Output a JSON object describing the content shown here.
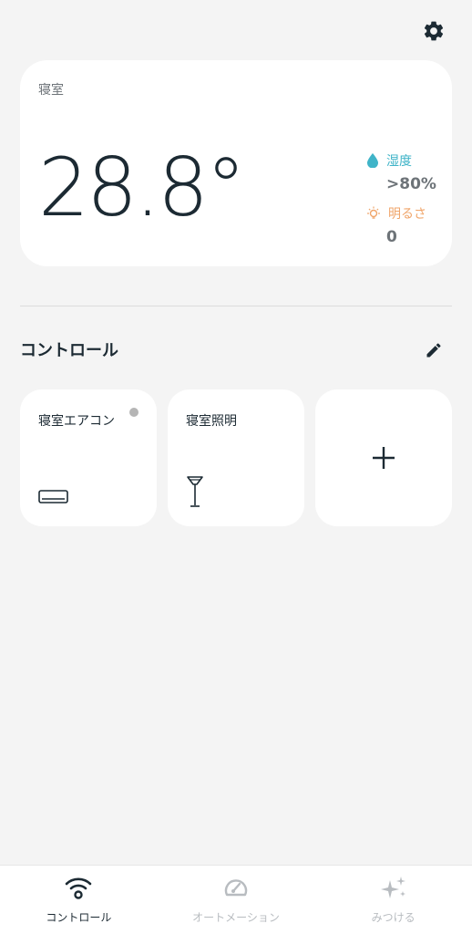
{
  "room": {
    "name": "寝室",
    "temperature": "28.8°",
    "humidity_label": "湿度",
    "humidity_value": ">80%",
    "brightness_label": "明るさ",
    "brightness_value": "0"
  },
  "controls": {
    "title": "コントロール",
    "devices": [
      {
        "label": "寝室エアコン",
        "icon": "air-conditioner-icon",
        "status": "offline"
      },
      {
        "label": "寝室照明",
        "icon": "floor-lamp-icon"
      }
    ],
    "add_icon": "plus-icon"
  },
  "tabs": [
    {
      "label": "コントロール",
      "icon": "wifi-icon",
      "active": true
    },
    {
      "label": "オートメーション",
      "icon": "automation-icon",
      "active": false
    },
    {
      "label": "みつける",
      "icon": "sparkle-icon",
      "active": false
    }
  ],
  "colors": {
    "background": "#f4f4f4",
    "card": "#ffffff",
    "humidity": "#40b4c8",
    "brightness": "#f0a56a",
    "text_dark": "#1c2a33",
    "inactive": "#b8bcc0"
  }
}
